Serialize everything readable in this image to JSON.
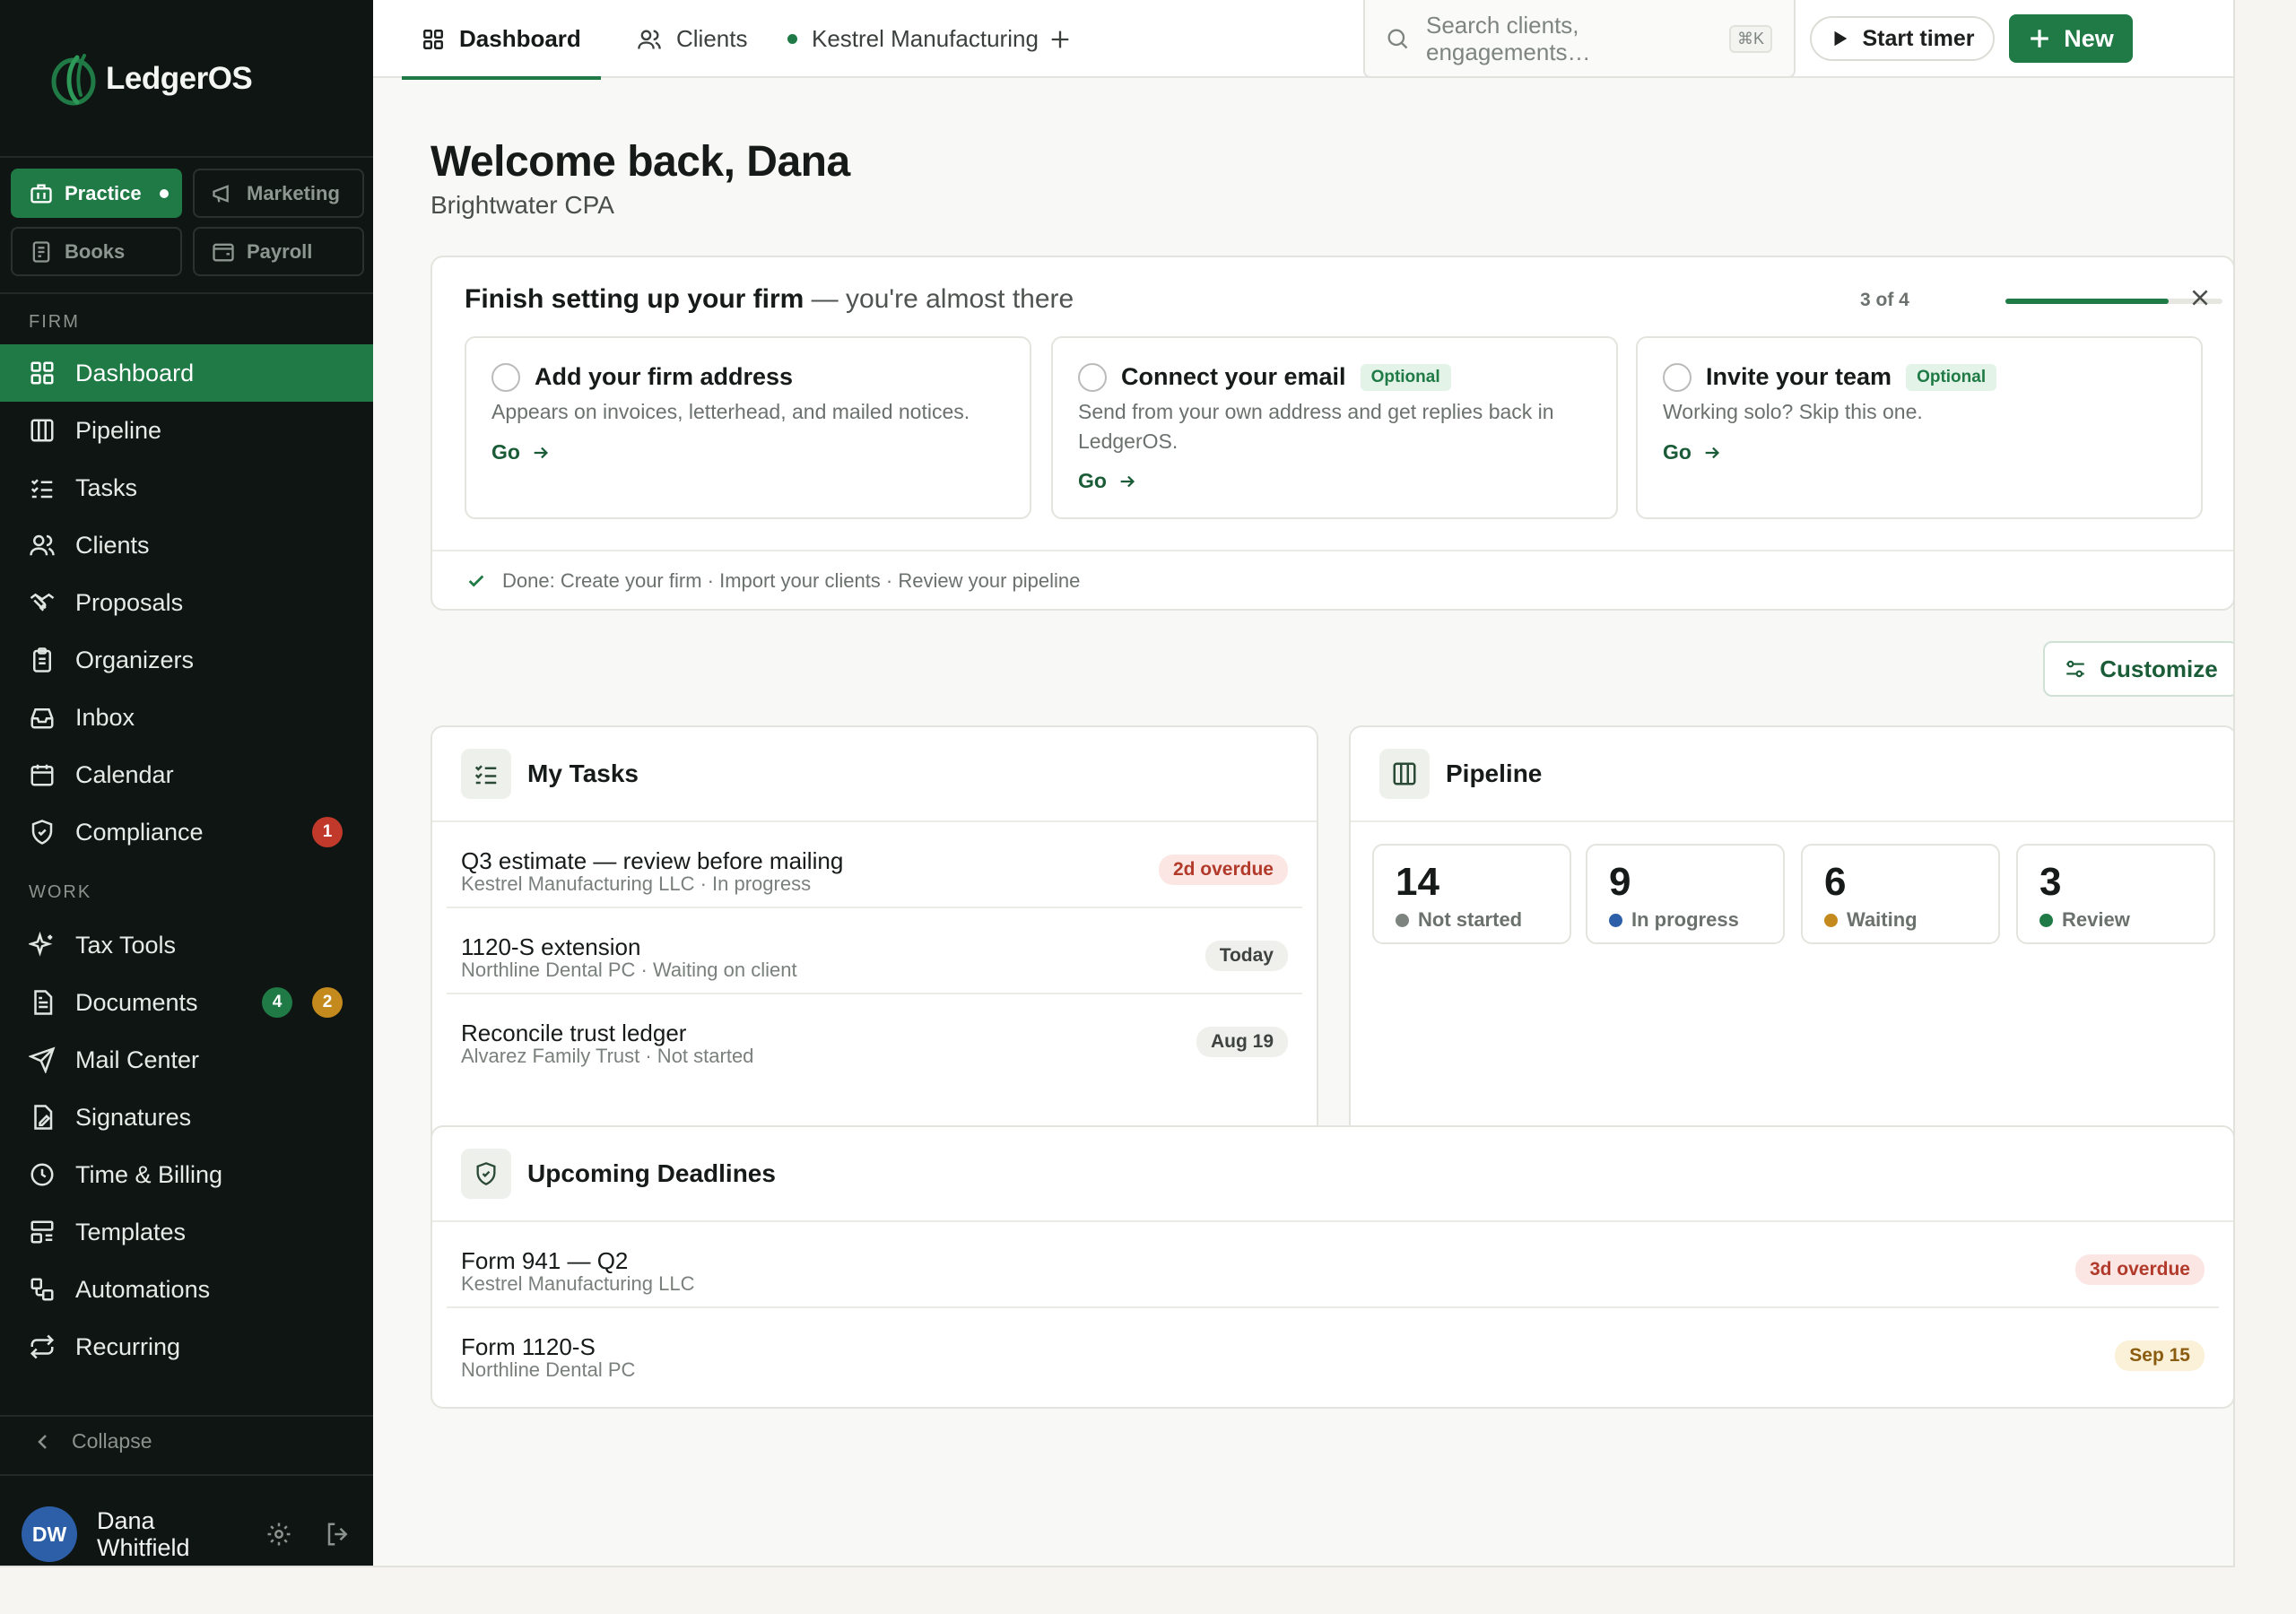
{
  "brand": {
    "name": "LedgerOS",
    "accent": "#1f7a45",
    "sidebar_bg": "#0f1512"
  },
  "workspaces": [
    {
      "label": "Practice",
      "icon": "briefcase-icon",
      "active": true
    },
    {
      "label": "Marketing",
      "icon": "megaphone-icon",
      "active": false
    },
    {
      "label": "Books",
      "icon": "ledger-book-icon",
      "active": false
    },
    {
      "label": "Payroll",
      "icon": "payroll-icon",
      "active": false
    }
  ],
  "sidebar": {
    "firm_label": "FIRM",
    "work_label": "WORK",
    "firm_items": [
      {
        "label": "Dashboard",
        "icon": "grid-icon",
        "active": true
      },
      {
        "label": "Pipeline",
        "icon": "columns-icon"
      },
      {
        "label": "Tasks",
        "icon": "checklist-icon"
      },
      {
        "label": "Clients",
        "icon": "users-icon"
      },
      {
        "label": "Proposals",
        "icon": "handshake-icon"
      },
      {
        "label": "Organizers",
        "icon": "clipboard-icon"
      },
      {
        "label": "Inbox",
        "icon": "inbox-icon"
      },
      {
        "label": "Calendar",
        "icon": "calendar-icon"
      },
      {
        "label": "Compliance",
        "icon": "shield-icon",
        "badge": "1"
      }
    ],
    "work_items": [
      {
        "label": "Tax Tools",
        "icon": "sparkle-icon"
      },
      {
        "label": "Documents",
        "icon": "document-icon",
        "badge_green": "4",
        "badge_amber": "2"
      },
      {
        "label": "Mail Center",
        "icon": "send-icon"
      },
      {
        "label": "Signatures",
        "icon": "signature-icon"
      },
      {
        "label": "Time & Billing",
        "icon": "clock-icon"
      },
      {
        "label": "Templates",
        "icon": "template-icon"
      },
      {
        "label": "Automations",
        "icon": "automation-icon"
      },
      {
        "label": "Recurring",
        "icon": "repeat-icon"
      }
    ],
    "collapse_label": "Collapse",
    "user": {
      "initials": "DW",
      "name": "Dana Whitfield"
    }
  },
  "topbar": {
    "tabs": [
      {
        "label": "Dashboard",
        "icon": "grid-icon",
        "active": true
      },
      {
        "label": "Clients",
        "icon": "users-icon"
      },
      {
        "label": "Kestrel Manufacturing",
        "icon": "status-dot"
      }
    ],
    "search_placeholder": "Search clients, engagements…",
    "search_shortcut": "⌘K",
    "timer_label": "Start timer",
    "new_label": "New"
  },
  "main": {
    "welcome": "Welcome back, Dana",
    "firm_name": "Brightwater CPA",
    "setup": {
      "title": "Finish setting up your firm",
      "subtitle": " — you're almost there",
      "progress_label": "3 of 4",
      "progress_fraction": 0.75,
      "steps": [
        {
          "title": "Add your firm address",
          "desc": "Appears on invoices, letterhead, and mailed notices.",
          "go": "Go"
        },
        {
          "title": "Connect your email",
          "badge": "Optional",
          "desc": "Send from your own address and get replies back in LedgerOS.",
          "go": "Go"
        },
        {
          "title": "Invite your team",
          "badge": "Optional",
          "desc": "Working solo? Skip this one.",
          "go": "Go"
        }
      ],
      "done_text": "Done: Create your firm · Import your clients · Review your pipeline"
    },
    "customize_label": "Customize",
    "tasks": {
      "title": "My Tasks",
      "rows": [
        {
          "title": "Q3 estimate — review before mailing",
          "sub": "Kestrel Manufacturing LLC · In progress",
          "pill": "2d overdue"
        },
        {
          "title": "1120-S extension",
          "sub": "Northline Dental PC · Waiting on client",
          "pill": "Today"
        },
        {
          "title": "Reconcile trust ledger",
          "sub": "Alvarez Family Trust · Not started",
          "pill": "Aug 19"
        }
      ]
    },
    "pipeline": {
      "title": "Pipeline",
      "stages": [
        {
          "count": "14",
          "label": "Not started",
          "color": "#7d837f"
        },
        {
          "count": "9",
          "label": "In progress",
          "color": "#2c5fa8"
        },
        {
          "count": "6",
          "label": "Waiting",
          "color": "#c48a1d"
        },
        {
          "count": "3",
          "label": "Review",
          "color": "#1f7a45"
        }
      ]
    },
    "deadlines": {
      "title": "Upcoming Deadlines",
      "rows": [
        {
          "title": "Form 941 — Q2",
          "sub": "Kestrel Manufacturing LLC",
          "pill": "3d overdue"
        },
        {
          "title": "Form 1120-S",
          "sub": "Northline Dental PC",
          "pill": "Sep 15"
        }
      ]
    }
  }
}
